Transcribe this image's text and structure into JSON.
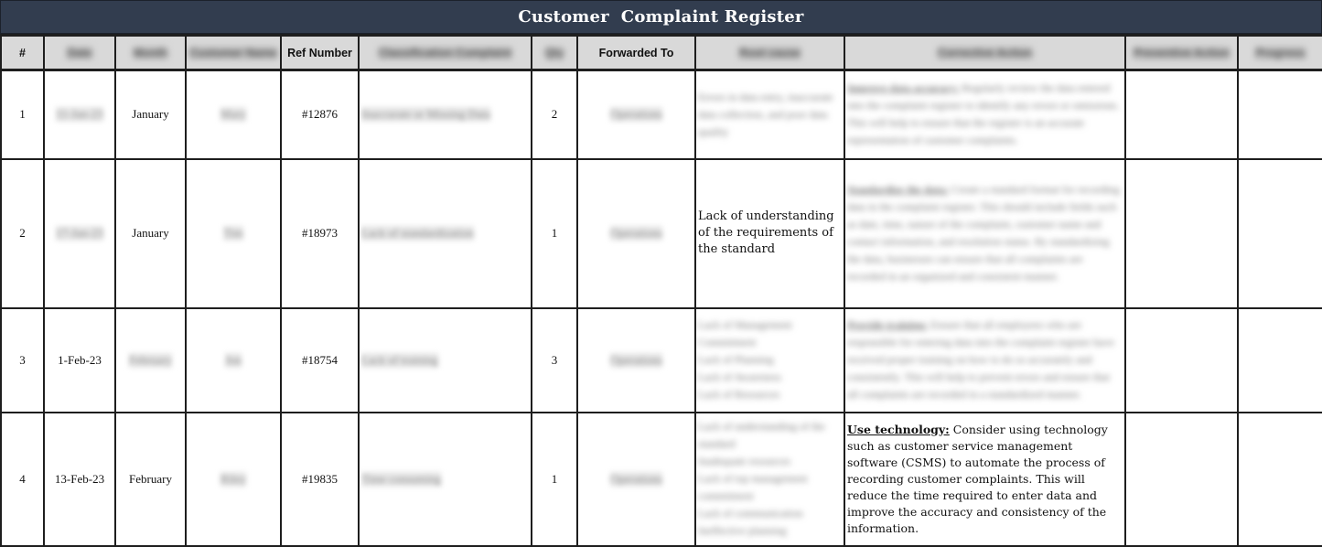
{
  "title": "Customer  Complaint Register",
  "columns": [
    {
      "key": "num",
      "label": "#",
      "redacted": false
    },
    {
      "key": "date",
      "label": "Date",
      "redacted": true
    },
    {
      "key": "month",
      "label": "Month",
      "redacted": true
    },
    {
      "key": "customer",
      "label": "Customer Name",
      "redacted": true
    },
    {
      "key": "ref",
      "label": "Ref Number",
      "redacted": false
    },
    {
      "key": "classification",
      "label": "Classification Complaint",
      "redacted": true
    },
    {
      "key": "qty",
      "label": "Qty",
      "redacted": true
    },
    {
      "key": "forwarded",
      "label": "Forwarded To",
      "redacted": false
    },
    {
      "key": "root_cause",
      "label": "Root cause",
      "redacted": true
    },
    {
      "key": "corrective",
      "label": "Corrective Action",
      "redacted": true
    },
    {
      "key": "preventive",
      "label": "Preventive Action",
      "redacted": true
    },
    {
      "key": "progress",
      "label": "Progress",
      "redacted": true
    }
  ],
  "rows": [
    {
      "num": "1",
      "date": "11-Jan-23",
      "month": "January",
      "customer": "Mary",
      "ref": "#12876",
      "classification": "Inaccurate or Missing Data",
      "qty": "2",
      "forwarded": "Operations",
      "root_cause": "Errors in data entry, inaccurate data collection, and poor data quality",
      "corrective_lead": "Improve data accuracy:",
      "corrective_body": "Regularly review the data entered into the complaint register to identify any errors or omissions. This will help to ensure that the register is an accurate representation of customer complaints.",
      "preventive": "",
      "progress": ""
    },
    {
      "num": "2",
      "date": "17-Jan-23",
      "month": "January",
      "customer": "Tim",
      "ref": "#18973",
      "classification": "Lack of standardization",
      "qty": "1",
      "forwarded": "Operations",
      "root_cause": "Lack of understanding of the requirements of the standard",
      "corrective_lead": "Standardize the data:",
      "corrective_body": "Create a standard format for recording data in the complaint register. This should include fields such as date, time, nature of the complaint, customer name and contact information, and resolution status. By standardizing the data, businesses can ensure that all complaints are recorded in an organized and consistent manner.",
      "preventive": "",
      "progress": ""
    },
    {
      "num": "3",
      "date": "1-Feb-23",
      "month": "February",
      "customer": "Jon",
      "ref": "#18754",
      "classification": "Lack of training",
      "qty": "3",
      "forwarded": "Operations",
      "root_cause": "Lack of Management Commitment\nLack of Planning\nLack of Awareness\nLack of Resources",
      "corrective_lead": "Provide training:",
      "corrective_body": "Ensure that all employees who are responsible for entering data into the complaint register have received proper training on how to do so accurately and consistently. This will help to prevent errors and ensure that all complaints are recorded in a standardized manner.",
      "preventive": "",
      "progress": ""
    },
    {
      "num": "4",
      "date": "13-Feb-23",
      "month": "February",
      "customer": "Riley",
      "ref": "#19835",
      "classification": "Time consuming",
      "qty": "1",
      "forwarded": "Operations",
      "root_cause": "Lack of understanding of the standard\nInadequate resources\nLack of top management commitment\nLack of communication\nIneffective planning",
      "corrective_lead": "Use technology:",
      "corrective_body": " Consider using technology such as customer service management software (CSMS) to automate the process of recording customer complaints. This will reduce the time required to enter data and improve the accuracy and consistency of the information.",
      "preventive": "",
      "progress": ""
    }
  ],
  "visibility": {
    "row_1": {
      "date": false,
      "month": true,
      "customer": false,
      "classification": false,
      "qty": true,
      "forwarded": false,
      "root_cause": false,
      "corrective": false
    },
    "row_2": {
      "date": false,
      "month": true,
      "customer": false,
      "classification": false,
      "qty": true,
      "forwarded": false,
      "root_cause": true,
      "corrective": false
    },
    "row_3": {
      "date": true,
      "month": false,
      "customer": false,
      "classification": false,
      "qty": true,
      "forwarded": false,
      "root_cause": false,
      "corrective": false
    },
    "row_4": {
      "date": true,
      "month": true,
      "customer": false,
      "classification": false,
      "qty": true,
      "forwarded": false,
      "root_cause": false,
      "corrective": true
    }
  },
  "colors": {
    "title_bg": "#323d4f",
    "title_text": "#ffffff",
    "header_bg": "#d9d9d9",
    "border": "#1e1e1e"
  }
}
